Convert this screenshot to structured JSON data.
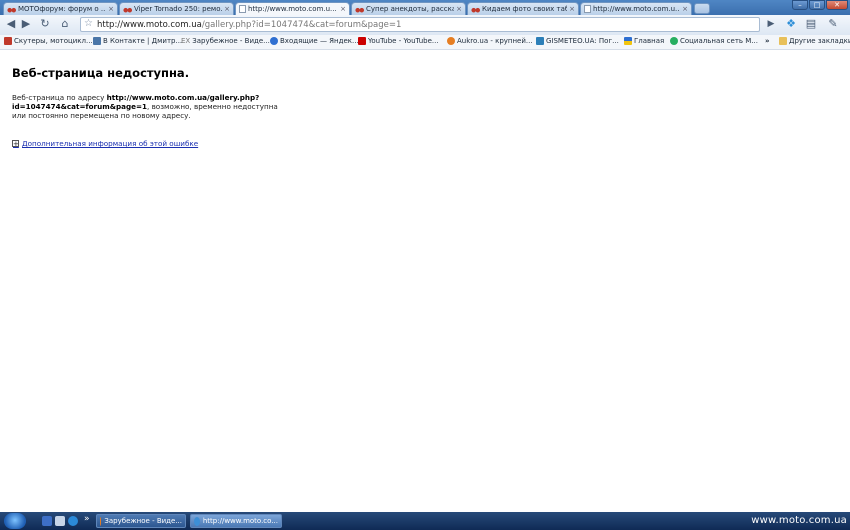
{
  "tabs": [
    {
      "title": "МОТОфорум: форум о ...",
      "icon": "moto-icon"
    },
    {
      "title": "Viper Tornado 250: ремо...",
      "icon": "moto-icon"
    },
    {
      "title": "http://www.moto.com.u...",
      "icon": "page-icon",
      "active": true
    },
    {
      "title": "Супер анекдоты, расска...",
      "icon": "moto-icon"
    },
    {
      "title": "Кидаем фото своих табу...",
      "icon": "moto-icon"
    },
    {
      "title": "http://www.moto.com.u...",
      "icon": "page-icon"
    }
  ],
  "tab_close": "×",
  "omnibox": {
    "domain": "http://www.moto.com.ua",
    "path": "/gallery.php?id=1047474&cat=forum&page=1"
  },
  "bookmarks": [
    {
      "label": "Скутеры, мотоцикл...",
      "color": "#c0392b"
    },
    {
      "label": "В Контакте | Дмитр...",
      "color": "#4a76a8"
    },
    {
      "label": "Зарубежное - Виде...",
      "color": "#8a8a8a",
      "prefix": "EX"
    },
    {
      "label": "Входящие — Яндек...",
      "color": "#2f6fd1"
    },
    {
      "label": "YouTube - YouTube...",
      "color": "#cc0000"
    },
    {
      "label": "Aukro.ua - крупней...",
      "color": "#e67e22"
    },
    {
      "label": "GISMETEO.UA: Пог...",
      "color": "#2c7fb8"
    },
    {
      "label": "Главная",
      "color": "#f1c40f"
    },
    {
      "label": "Социальная сеть М...",
      "color": "#27ae60"
    }
  ],
  "bookmarks_more": "»",
  "other_bookmarks": "Другие закладки",
  "error": {
    "title": "Веб-страница недоступна.",
    "text_prefix": "Веб-страница по адресу ",
    "url_line1": "http://www.moto.com.ua/gallery.php?",
    "url_line2": "id=1047474&cat=forum&page=1",
    "text_suffix": ", возможно, временно недоступна или постоянно перемещена по новому адресу.",
    "more_link": "Дополнительная информация об этой ошибке",
    "more_icon": "+"
  },
  "taskbar": {
    "tasks": [
      {
        "label": "Зарубежное - Виде...",
        "color": "#e67e22"
      },
      {
        "label": "http://www.moto.co...",
        "color": "#3d8fd6",
        "active": true
      }
    ],
    "watermark": "www.moto.com.ua"
  }
}
